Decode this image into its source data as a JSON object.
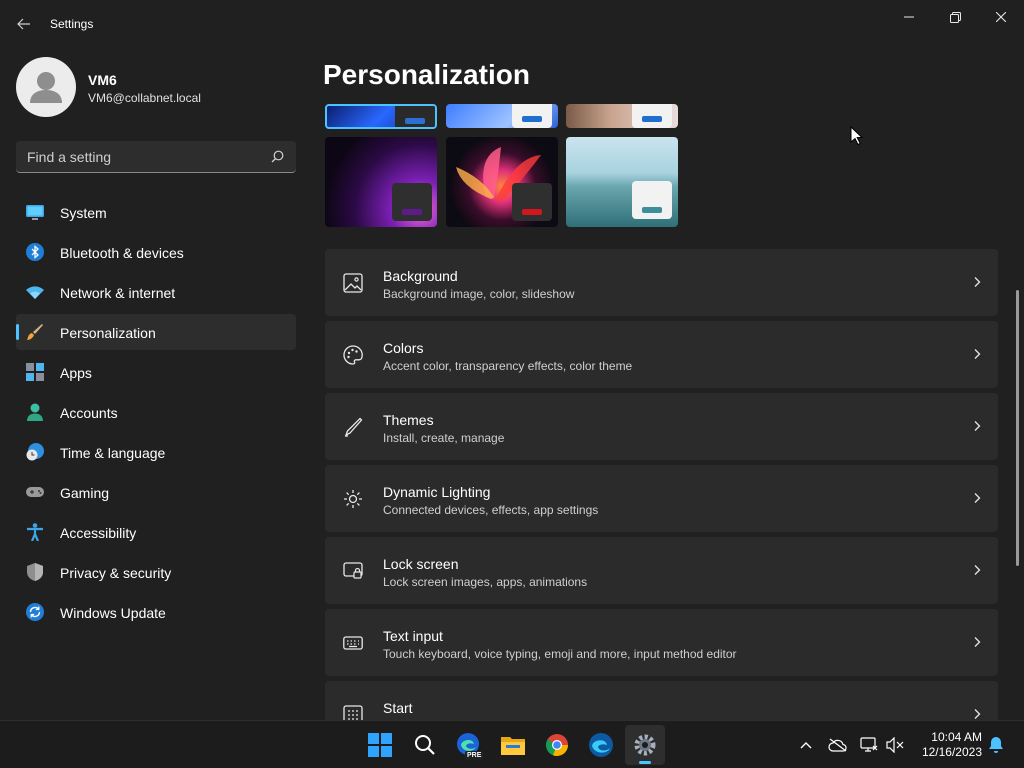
{
  "window": {
    "title": "Settings"
  },
  "profile": {
    "name": "VM6",
    "email": "VM6@collabnet.local"
  },
  "search": {
    "placeholder": "Find a setting"
  },
  "sidebar": {
    "items": [
      {
        "label": "System",
        "icon": "monitor-icon",
        "active": false
      },
      {
        "label": "Bluetooth & devices",
        "icon": "bluetooth-icon",
        "active": false
      },
      {
        "label": "Network & internet",
        "icon": "wifi-icon",
        "active": false
      },
      {
        "label": "Personalization",
        "icon": "paintbrush-icon",
        "active": true
      },
      {
        "label": "Apps",
        "icon": "apps-icon",
        "active": false
      },
      {
        "label": "Accounts",
        "icon": "person-icon",
        "active": false
      },
      {
        "label": "Time & language",
        "icon": "globe-clock-icon",
        "active": false
      },
      {
        "label": "Gaming",
        "icon": "gamepad-icon",
        "active": false
      },
      {
        "label": "Accessibility",
        "icon": "accessibility-icon",
        "active": false
      },
      {
        "label": "Privacy & security",
        "icon": "shield-icon",
        "active": false
      },
      {
        "label": "Windows Update",
        "icon": "update-icon",
        "active": false
      }
    ]
  },
  "main": {
    "title": "Personalization",
    "cards": [
      {
        "title": "Background",
        "subtitle": "Background image, color, slideshow",
        "icon": "image-icon"
      },
      {
        "title": "Colors",
        "subtitle": "Accent color, transparency effects, color theme",
        "icon": "palette-icon"
      },
      {
        "title": "Themes",
        "subtitle": "Install, create, manage",
        "icon": "pen-icon"
      },
      {
        "title": "Dynamic Lighting",
        "subtitle": "Connected devices, effects, app settings",
        "icon": "lighting-icon"
      },
      {
        "title": "Lock screen",
        "subtitle": "Lock screen images, apps, animations",
        "icon": "lock-screen-icon"
      },
      {
        "title": "Text input",
        "subtitle": "Touch keyboard, voice typing, emoji and more, input method editor",
        "icon": "keyboard-icon"
      },
      {
        "title": "Start",
        "subtitle": "",
        "icon": "start-grid-icon"
      }
    ]
  },
  "taskbar": {
    "apps": [
      "start-icon",
      "search-icon",
      "edge-preview-icon",
      "file-explorer-icon",
      "chrome-icon",
      "edge-icon",
      "settings-icon"
    ],
    "edge_badge": "PRE",
    "time": "10:04 AM",
    "date": "12/16/2023"
  },
  "colors": {
    "background": "#202020",
    "card": "#2b2b2b",
    "accent": "#4cc2ff"
  }
}
